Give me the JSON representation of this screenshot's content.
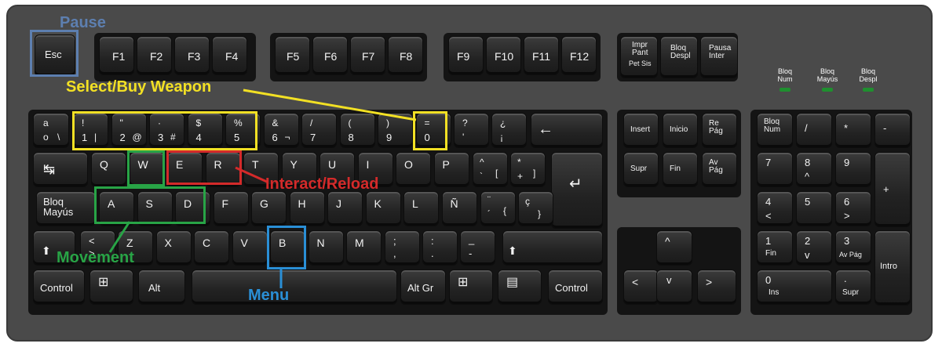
{
  "colors": {
    "pause": "#5d7fb0",
    "weapon": "#f2e024",
    "interact": "#d42a2a",
    "movement": "#28a446",
    "menu": "#2a8fd6"
  },
  "annotations": {
    "pause": "Pause",
    "weapon": "Select/Buy Weapon",
    "interact": "Interact/Reload",
    "movement": "Movement",
    "menu": "Menu"
  },
  "leds": [
    "Bloq\nNum",
    "Bloq\nMayús",
    "Bloq\nDespl"
  ],
  "keys": {
    "esc": "Esc",
    "f1": "F1",
    "f2": "F2",
    "f3": "F3",
    "f4": "F4",
    "f5": "F5",
    "f6": "F6",
    "f7": "F7",
    "f8": "F8",
    "f9": "F9",
    "f10": "F10",
    "f11": "F11",
    "f12": "F12",
    "impr": "Impr\nPant",
    "petsis": "Pet Sis",
    "bloqdespl": "Bloq\nDespl",
    "pausa": "Pausa\nInter",
    "n1": [
      "!",
      "1",
      "|"
    ],
    "n2": [
      "\"",
      "2",
      "@"
    ],
    "n3": [
      "·",
      "3",
      "#"
    ],
    "n4": [
      "$",
      "4"
    ],
    "n5": [
      "%",
      "5"
    ],
    "n6": [
      "&",
      "6",
      "¬"
    ],
    "n7": [
      "/",
      "7"
    ],
    "n8": [
      "(",
      "8"
    ],
    "n9": [
      ")",
      "9"
    ],
    "n0": [
      "=",
      "0"
    ],
    "q_top": "?",
    "q_bot": "'",
    "exc_top": "¿",
    "exc_bot": "¡",
    "ord_top": "a",
    "ord_bot": "o",
    "ord_alt": "\\",
    "backspace": "←",
    "tab": "↹",
    "q": "Q",
    "w": "W",
    "e": "E",
    "r": "R",
    "t": "T",
    "y": "Y",
    "u": "U",
    "i": "I",
    "o": "O",
    "p": "P",
    "grave": [
      "^",
      "`",
      "["
    ],
    "plus": [
      "*",
      "+",
      "]"
    ],
    "enter": "↵",
    "caps": "Bloq\nMayús",
    "a": "A",
    "s": "S",
    "d": "D",
    "f": "F",
    "g": "G",
    "h": "H",
    "j": "J",
    "k": "K",
    "l": "L",
    "enye": "Ñ",
    "acc": [
      "¨",
      "´",
      "{"
    ],
    "cced": [
      "ç",
      "}"
    ],
    "lshift": "⬆",
    "lt": [
      "<",
      ">"
    ],
    "z": "Z",
    "x": "X",
    "c": "C",
    "v": "V",
    "b": "B",
    "n": "N",
    "m": "M",
    "comma": [
      ";",
      ","
    ],
    "period": [
      ":",
      "."
    ],
    "minus": [
      "_",
      "-"
    ],
    "rshift": "⬆",
    "lctrl": "Control",
    "win": "⊞",
    "alt": "Alt",
    "altgr": "Alt Gr",
    "menu": "▤",
    "rctrl": "Control",
    "ins": "Insert",
    "inicio": "Inicio",
    "repag": "Re\nPág",
    "supr": "Supr",
    "fin": "Fin",
    "avpag": "Av\nPág",
    "up": "^",
    "left": "<",
    "down": "v",
    "right": ">",
    "numlock": "Bloq\nNum",
    "div": "/",
    "mul": "*",
    "sub": "-",
    "np7": "7",
    "np8": [
      "8",
      "^"
    ],
    "np9": "9",
    "add": "+",
    "np4": [
      "4",
      "<"
    ],
    "np5": "5",
    "np6": [
      "6",
      ">"
    ],
    "np1": [
      "1",
      "Fin"
    ],
    "np2": [
      "2",
      "v"
    ],
    "np3": [
      "3",
      "Av Pág"
    ],
    "intro": "Intro",
    "np0": [
      "0",
      "Ins"
    ],
    "npdot": [
      ".",
      "Supr"
    ]
  }
}
